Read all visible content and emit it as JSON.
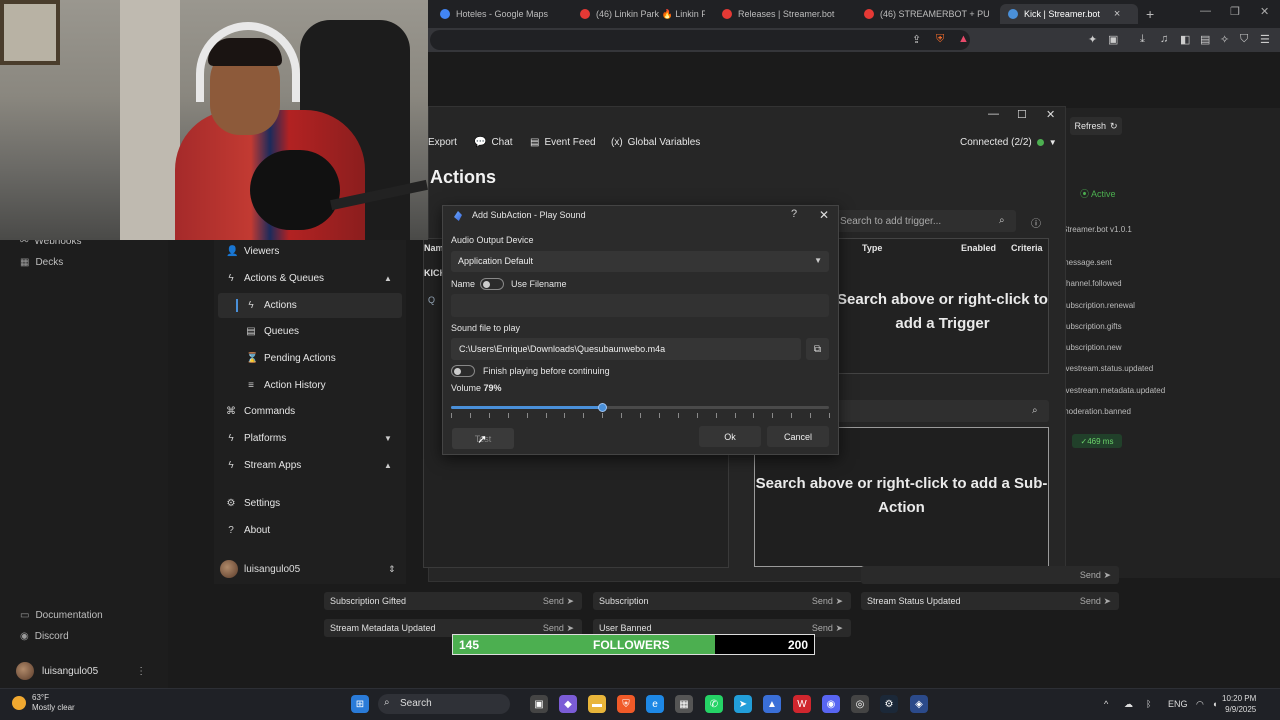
{
  "browser": {
    "tabs": [
      {
        "title": "Hoteles - Google Maps",
        "icon_color": "#4285f4"
      },
      {
        "title": "(46) Linkin Park 🔥 Linkin Park",
        "icon_color": "#e53935"
      },
      {
        "title": "Releases | Streamer.bot",
        "icon_color": "#e53935"
      },
      {
        "title": "(46) STREAMERBOT + PUNTO",
        "icon_color": "#e53935"
      },
      {
        "title": "Kick | Streamer.bot",
        "icon_color": "#4a90d9"
      }
    ],
    "new_tab": "+",
    "close_tab": "×"
  },
  "left_strip": {
    "webhooks": "Webhooks",
    "decks": "Decks",
    "documentation": "Documentation",
    "discord": "Discord",
    "username": "luisangulo05"
  },
  "app": {
    "topbar": {
      "export": "Export",
      "chat": "Chat",
      "event_feed": "Event Feed",
      "global_variables": "Global Variables",
      "connected": "Connected (2/2)",
      "refresh": "Refresh"
    },
    "page_title": "Actions",
    "triggers": {
      "search_placeholder": "Search to add trigger...",
      "columns": [
        "Type",
        "Enabled",
        "Criteria"
      ],
      "empty": "Search above or right-click to add a Trigger"
    },
    "subactions": {
      "search_placeholder": "Search to add Sub-Action...",
      "empty": "Search above or right-click to add a Sub-Action"
    },
    "actions_table": {
      "header": "Name",
      "group": "KICK",
      "row": "Q"
    },
    "right_panel": {
      "status": "Active",
      "version": "Streamer.bot v1.0.1",
      "events": [
        "message.sent",
        "channel.followed",
        "subscription.renewal",
        "subscription.gifts",
        "subscription.new",
        "livestream.status.updated",
        "livestream.metadata.updated",
        "moderation.banned"
      ],
      "latency": "469 ms"
    }
  },
  "sidebar": {
    "viewers": "Viewers",
    "actions_queues": "Actions & Queues",
    "actions": "Actions",
    "queues": "Queues",
    "pending_actions": "Pending Actions",
    "action_history": "Action History",
    "commands": "Commands",
    "platforms": "Platforms",
    "stream_apps": "Stream Apps",
    "settings": "Settings",
    "about": "About",
    "username": "luisangulo05"
  },
  "send_rows": [
    {
      "label": "Subscription Gifted",
      "send": "Send"
    },
    {
      "label": "Subscription",
      "send": "Send"
    },
    {
      "label": "Stream Status Updated",
      "send": "Send"
    },
    {
      "label": "Stream Metadata Updated",
      "send": "Send"
    },
    {
      "label": "User Banned",
      "send": "Send"
    },
    {
      "label": "",
      "send": "Send"
    }
  ],
  "dialog": {
    "title": "Add SubAction - Play Sound",
    "help": "?",
    "close": "✕",
    "audio_device_label": "Audio Output Device",
    "audio_device_value": "Application Default",
    "name_label": "Name",
    "use_filename_label": "Use Filename",
    "use_filename_on": false,
    "name_value": "",
    "sound_file_label": "Sound file to play",
    "sound_file_value": "C:\\Users\\Enrique\\Downloads\\Quesubaunwebo.m4a",
    "finish_label": "Finish playing before continuing",
    "finish_on": false,
    "volume_label": "Volume",
    "volume_value": "79%",
    "volume_fraction": 0.4,
    "test": "Test",
    "ok": "Ok",
    "cancel": "Cancel"
  },
  "followers_goal": {
    "current": "145",
    "label": "FOLLOWERS",
    "target": "200",
    "progress": 0.725
  },
  "taskbar": {
    "temperature": "63°F",
    "condition": "Mostly clear",
    "search": "Search",
    "language": "ENG",
    "time": "10:20 PM",
    "date": "9/9/2025"
  }
}
